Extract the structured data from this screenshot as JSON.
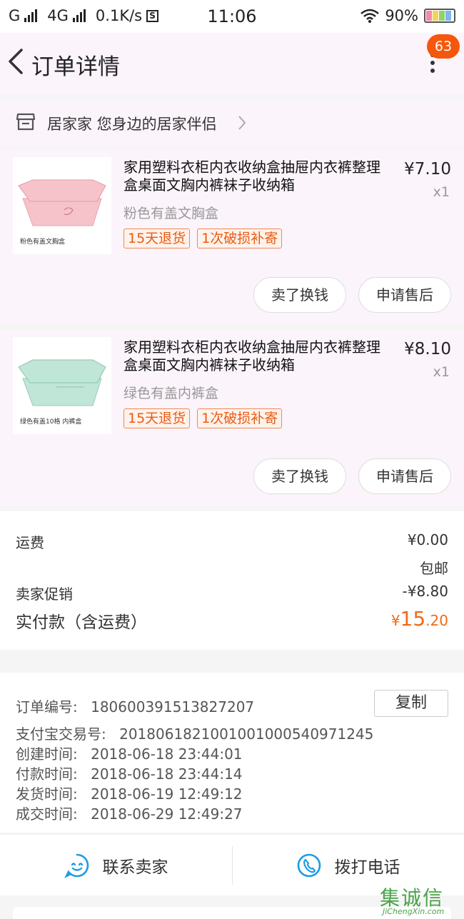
{
  "status_bar": {
    "carrier1": "G",
    "carrier2": "4G",
    "net_speed": "0.1K/s",
    "sim_badge": "S",
    "time": "11:06",
    "battery": "90%"
  },
  "nav": {
    "title": "订单详情",
    "badge": "63"
  },
  "shop": {
    "name": "居家家 您身边的居家伴侣"
  },
  "items": [
    {
      "title": "家用塑料衣柜内衣收纳盒抽屉内衣裤整理盒桌面文胸内裤袜子收纳箱",
      "sku": "粉色有盖文胸盒",
      "price": "¥7.10",
      "qty": "x1",
      "thumb_caption": "粉色有盖文胸盒",
      "thumb_color": "#f6c3cb",
      "tags": [
        "15天退货",
        "1次破损补寄"
      ],
      "btn_sell": "卖了换钱",
      "btn_after_sale": "申请售后"
    },
    {
      "title": "家用塑料衣柜内衣收纳盒抽屉内衣裤整理盒桌面文胸内裤袜子收纳箱",
      "sku": "绿色有盖内裤盒",
      "price": "¥8.10",
      "qty": "x1",
      "thumb_caption": "绿色有盖10格 内裤盒",
      "thumb_color": "#bfe6d6",
      "tags": [
        "15天退货",
        "1次破损补寄"
      ],
      "btn_sell": "卖了换钱",
      "btn_after_sale": "申请售后"
    }
  ],
  "summary": {
    "shipping_label": "运费",
    "shipping_value": "¥0.00",
    "shipping_note": "包邮",
    "promo_label": "卖家促销",
    "promo_value": "-¥8.80",
    "paid_label": "实付款（含运费）",
    "paid_currency": "¥",
    "paid_int": "15",
    "paid_dec": ".20"
  },
  "order_info": {
    "order_no_label": "订单编号:",
    "order_no": "180600391513827207",
    "copy_label": "复制",
    "alipay_label": "支付宝交易号:",
    "alipay_no": "2018061821001001000540971245",
    "created_label": "创建时间:",
    "created": "2018-06-18 23:44:01",
    "paid_label": "付款时间:",
    "paid": "2018-06-18 23:44:14",
    "shipped_label": "发货时间:",
    "shipped": "2018-06-19 12:49:12",
    "done_label": "成交时间:",
    "done": "2018-06-29 12:49:27"
  },
  "actions": {
    "contact": "联系卖家",
    "call": "拨打电话"
  },
  "watermark": {
    "logo": "集诚信",
    "sub": "JiChengXin.com"
  },
  "colors": {
    "accent": "#f5570c",
    "price_orange": "#f06a16",
    "icon_blue": "#1e9be6"
  }
}
